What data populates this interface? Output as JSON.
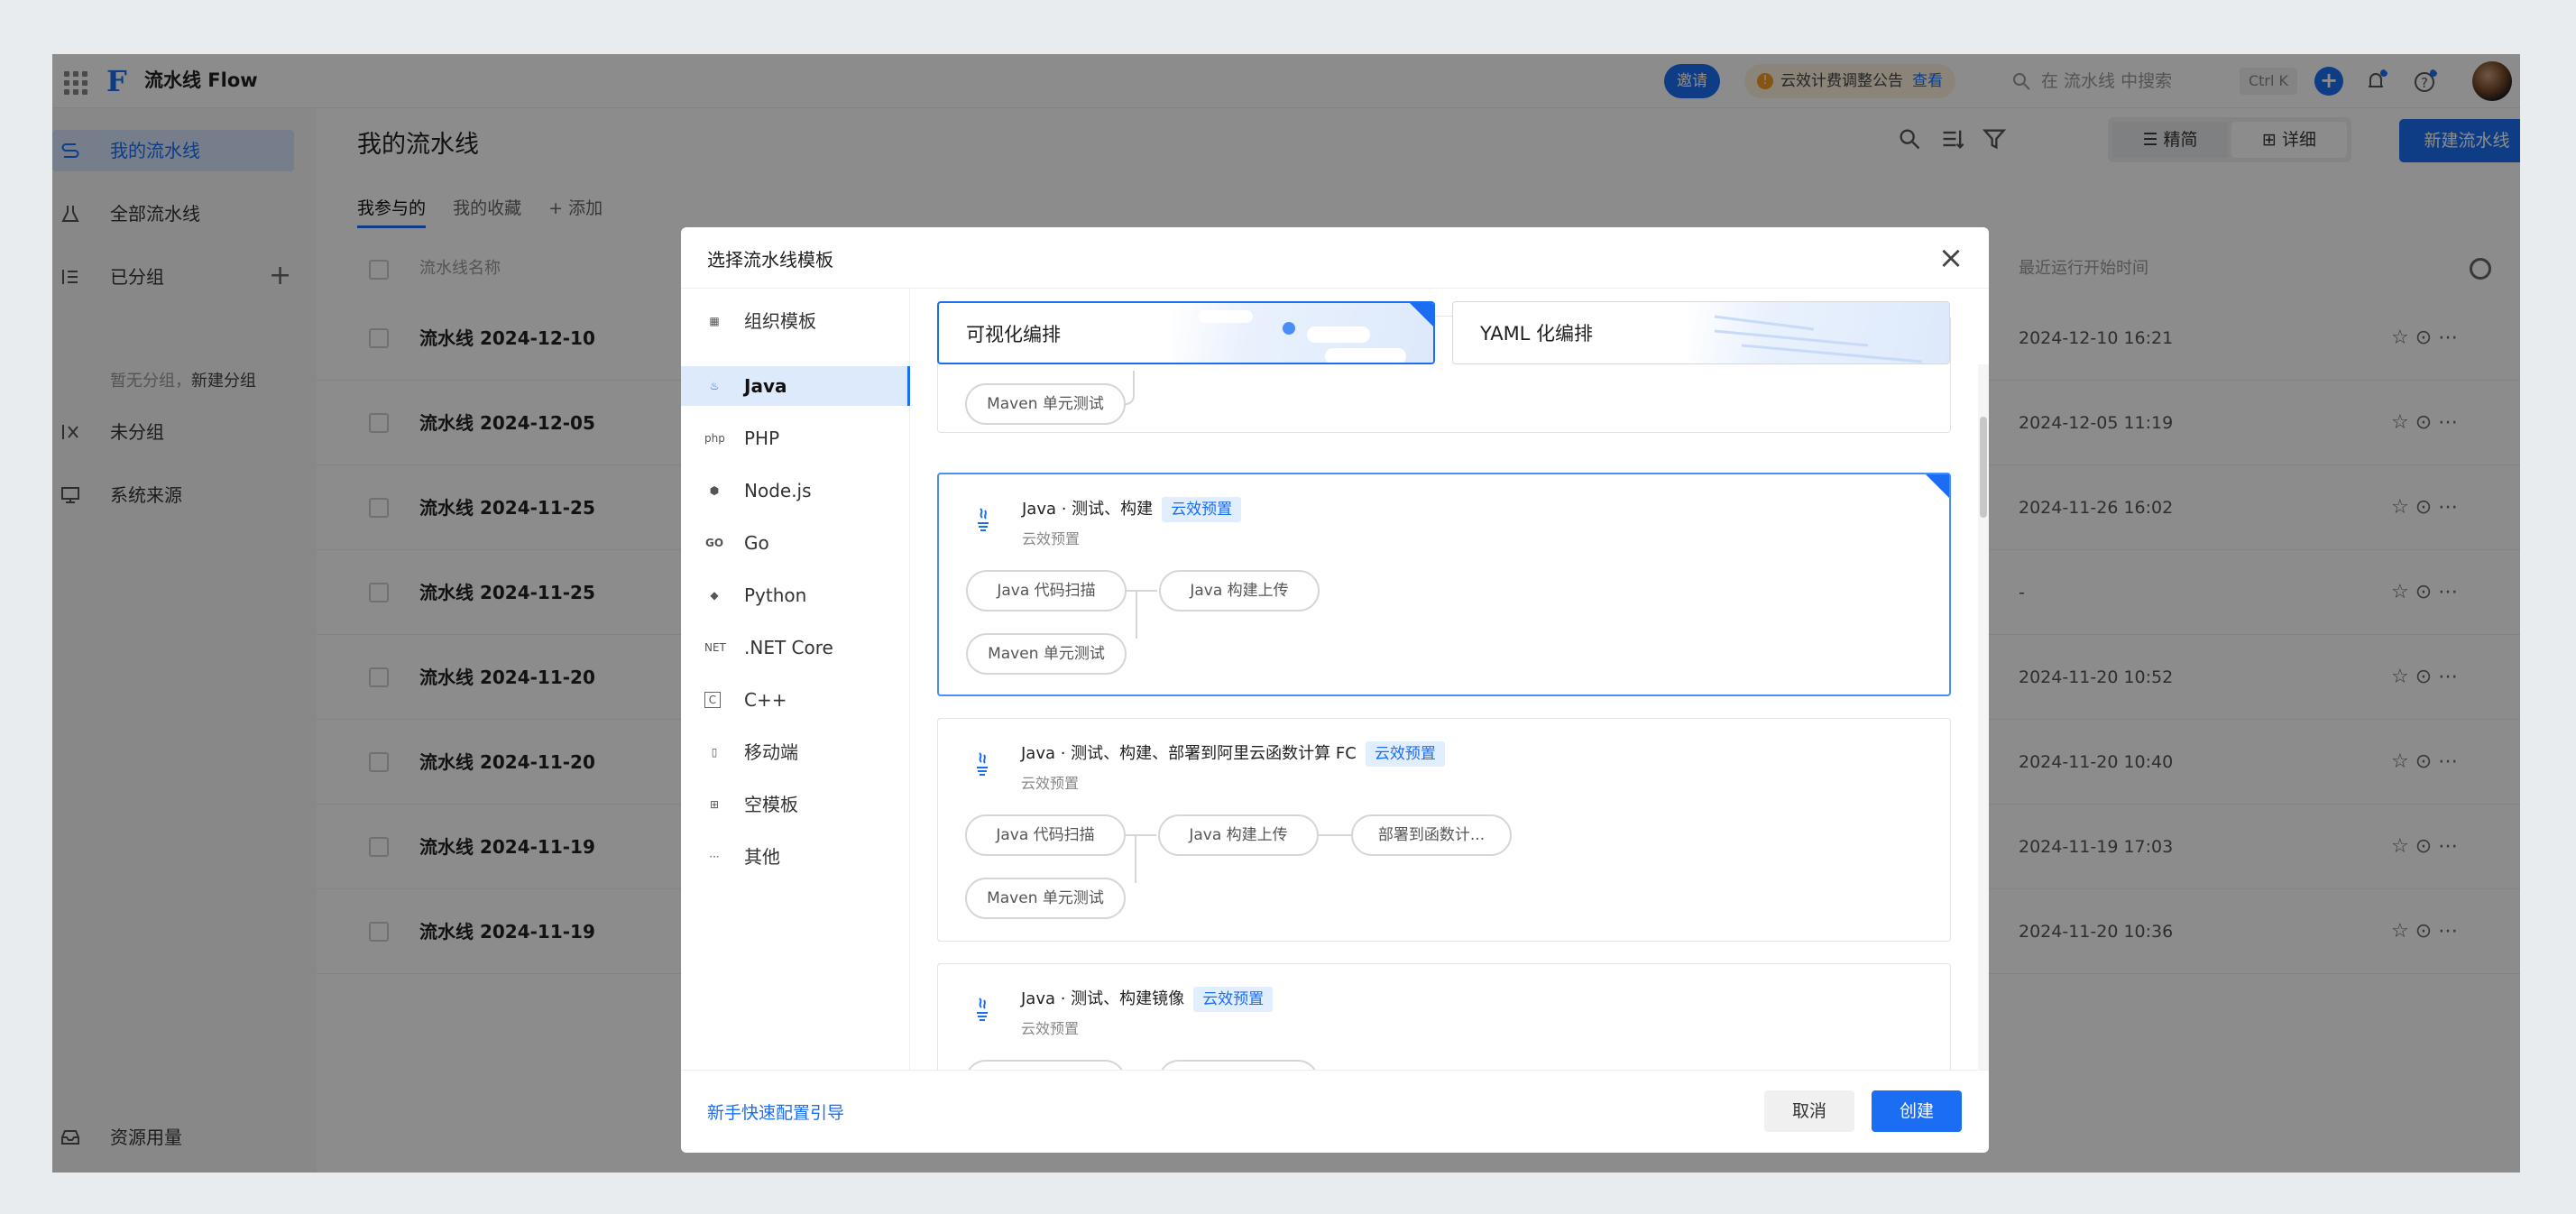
{
  "topbar": {
    "app_name": "流水线 Flow",
    "invite": "邀请",
    "notice_text": "云效计费调整公告",
    "notice_link": "查看",
    "search_placeholder": "在 流水线 中搜索",
    "search_shortcut": "Ctrl K"
  },
  "sidebar": {
    "items": [
      {
        "label": "我的流水线"
      },
      {
        "label": "全部流水线"
      },
      {
        "label": "已分组"
      },
      {
        "label": "未分组"
      },
      {
        "label": "系统来源"
      }
    ],
    "group_hint": "暂无分组，",
    "group_hint_link": "新建分组",
    "resource": "资源用量"
  },
  "main": {
    "title": "我的流水线",
    "tabs": [
      "我参与的",
      "我的收藏",
      "添加"
    ],
    "view_simple": "精简",
    "view_detail": "详细",
    "new_button": "新建流水线",
    "col_name": "流水线名称",
    "col_time": "最近运行开始时间",
    "rows": [
      {
        "name": "流水线 2024-12-10",
        "time": "2024-12-10 16:21"
      },
      {
        "name": "流水线 2024-12-05",
        "time": "2024-12-05 11:19"
      },
      {
        "name": "流水线 2024-11-25",
        "time": "2024-11-26 16:02"
      },
      {
        "name": "流水线 2024-11-25",
        "time": "-"
      },
      {
        "name": "流水线 2024-11-20",
        "time": "2024-11-20 10:52"
      },
      {
        "name": "流水线 2024-11-20",
        "time": "2024-11-20 10:40"
      },
      {
        "name": "流水线 2024-11-19",
        "time": "2024-11-19 17:03"
      },
      {
        "name": "流水线 2024-11-19",
        "time": "2024-11-20 10:36"
      }
    ]
  },
  "modal": {
    "title": "选择流水线模板",
    "categories": [
      {
        "icon": "grid",
        "label": "组织模板"
      },
      {
        "icon": "java",
        "label": "Java"
      },
      {
        "icon": "php",
        "label": "PHP"
      },
      {
        "icon": "node",
        "label": "Node.js"
      },
      {
        "icon": "go",
        "label": "Go"
      },
      {
        "icon": "python",
        "label": "Python"
      },
      {
        "icon": "net",
        "label": ".NET Core"
      },
      {
        "icon": "cpp",
        "label": "C++"
      },
      {
        "icon": "mobile",
        "label": "移动端"
      },
      {
        "icon": "empty",
        "label": "空模板"
      },
      {
        "icon": "more",
        "label": "其他"
      }
    ],
    "icon_text": {
      "php": "php",
      "go": "GO",
      "net": "NET",
      "cpp": "C",
      "more": "···"
    },
    "mode_visual": "可视化编排",
    "mode_yaml": "YAML 化编排",
    "badge": "云效预置",
    "subtitle": "云效预置",
    "partial_node": "Maven 单元测试",
    "cards": [
      {
        "title": "Java · 测试、构建",
        "nodes": [
          "Java 代码扫描",
          "Java 构建上传",
          "Maven 单元测试"
        ]
      },
      {
        "title": "Java · 测试、构建、部署到阿里云函数计算 FC",
        "nodes": [
          "Java 代码扫描",
          "Java 构建上传",
          "部署到函数计...",
          "Maven 单元测试"
        ]
      },
      {
        "title": "Java · 测试、构建镜像"
      }
    ],
    "guide_link": "新手快速配置引导",
    "cancel": "取消",
    "create": "创建"
  },
  "colors": {
    "accent": "#1b6ef3",
    "overlay": "rgba(0,0,0,0.45)"
  }
}
